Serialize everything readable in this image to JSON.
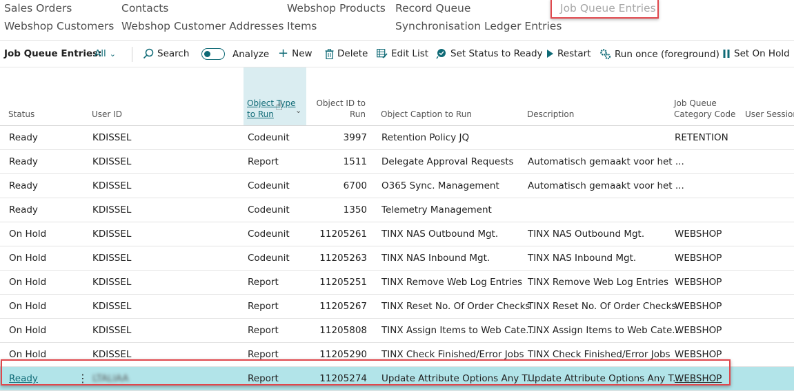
{
  "nav": {
    "items": [
      {
        "label": "Sales Orders"
      },
      {
        "label": "Contacts"
      },
      {
        "label": "Webshop Products"
      },
      {
        "label": "Record Queue"
      },
      {
        "label": "Job Queue Entries"
      },
      {
        "label": "Webshop Customers"
      },
      {
        "label": "Webshop Customer Addresses"
      },
      {
        "label": "Items"
      },
      {
        "label": "Synchronisation Ledger Entries"
      }
    ]
  },
  "toolbar": {
    "title": "Job Queue Entries:",
    "filter": "All",
    "search": "Search",
    "analyze": "Analyze",
    "new": "New",
    "delete": "Delete",
    "edit_list": "Edit List",
    "set_status": "Set Status to Ready",
    "restart": "Restart",
    "run_once": "Run once (foreground)",
    "set_on_hold": "Set On Hold"
  },
  "columns": {
    "status": "Status",
    "user_id": "User ID",
    "object_type_1": "Object Type",
    "object_type_2": "to Run",
    "object_id_1": "Object ID to",
    "object_id_2": "Run",
    "caption": "Object Caption to Run",
    "description": "Description",
    "category_1": "Job Queue",
    "category_2": "Category Code",
    "session": "User Session S"
  },
  "rows": [
    {
      "status": "Ready",
      "user": "KDISSEL",
      "type": "Codeunit",
      "id": "3997",
      "caption": "Retention Policy JQ",
      "description": "",
      "category": "RETENTION"
    },
    {
      "status": "Ready",
      "user": "KDISSEL",
      "type": "Report",
      "id": "1511",
      "caption": "Delegate Approval Requests",
      "description": "Automatisch gemaakt voor het ...",
      "category": ""
    },
    {
      "status": "Ready",
      "user": "KDISSEL",
      "type": "Codeunit",
      "id": "6700",
      "caption": "O365 Sync. Management",
      "description": "Automatisch gemaakt voor het ...",
      "category": ""
    },
    {
      "status": "Ready",
      "user": "KDISSEL",
      "type": "Codeunit",
      "id": "1350",
      "caption": "Telemetry Management",
      "description": "",
      "category": ""
    },
    {
      "status": "On Hold",
      "user": "KDISSEL",
      "type": "Codeunit",
      "id": "11205261",
      "caption": "TINX NAS Outbound Mgt.",
      "description": "TINX NAS Outbound Mgt.",
      "category": "WEBSHOP"
    },
    {
      "status": "On Hold",
      "user": "KDISSEL",
      "type": "Codeunit",
      "id": "11205263",
      "caption": "TINX NAS Inbound Mgt.",
      "description": "TINX NAS Inbound Mgt.",
      "category": "WEBSHOP"
    },
    {
      "status": "On Hold",
      "user": "KDISSEL",
      "type": "Report",
      "id": "11205251",
      "caption": "TINX Remove Web Log Entries",
      "description": "TINX Remove Web Log Entries",
      "category": "WEBSHOP"
    },
    {
      "status": "On Hold",
      "user": "KDISSEL",
      "type": "Report",
      "id": "11205267",
      "caption": "TINX Reset No. Of Order Checks",
      "description": "TINX Reset No. Of Order Checks",
      "category": "WEBSHOP"
    },
    {
      "status": "On Hold",
      "user": "KDISSEL",
      "type": "Report",
      "id": "11205808",
      "caption": "TINX Assign Items to Web Cate...",
      "description": "TINX Assign Items to Web Cate...",
      "category": "WEBSHOP"
    },
    {
      "status": "On Hold",
      "user": "KDISSEL",
      "type": "Report",
      "id": "11205290",
      "caption": "TINX Check Finished/Error Jobs",
      "description": "TINX Check Finished/Error Jobs",
      "category": "WEBSHOP"
    },
    {
      "status": "Ready",
      "user": "LTALIAA",
      "type": "Report",
      "id": "11205274",
      "caption": "Update Attribute Options Any T...",
      "description": "Update Attribute Options Any T...",
      "category": "WEBSHOP"
    }
  ]
}
